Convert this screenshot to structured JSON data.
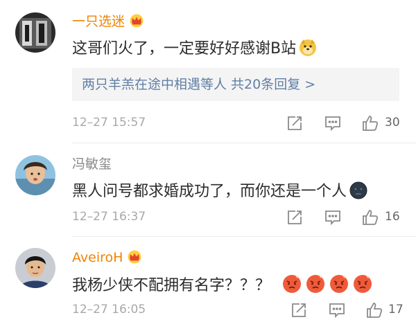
{
  "comments": [
    {
      "username": "一只选迷",
      "text": "这哥们火了，一定要好好感谢B站",
      "reply_summary": "两只羊羔在途中相遇等人 共20条回复 >",
      "timestamp": "12–27 15:57",
      "like_count": "30",
      "emoji": "doge-emoji"
    },
    {
      "username": "冯敏玺",
      "text": "黑人问号都求婚成功了，而你还是一个人",
      "timestamp": "12–27 16:37",
      "like_count": "16",
      "emoji": "dark-face-emoji"
    },
    {
      "username": "AveiroH",
      "text": "我杨少侠不配拥有名字？？？",
      "timestamp": "12–27 16:05",
      "like_count": "17",
      "emoji": "angry-face-emoji"
    }
  ],
  "colors": {
    "vip_name": "#f08300",
    "link": "#5f7fa6",
    "muted": "#a8a8a8"
  },
  "icons": [
    "vip-crown-icon",
    "share-icon",
    "comment-icon",
    "like-icon"
  ]
}
